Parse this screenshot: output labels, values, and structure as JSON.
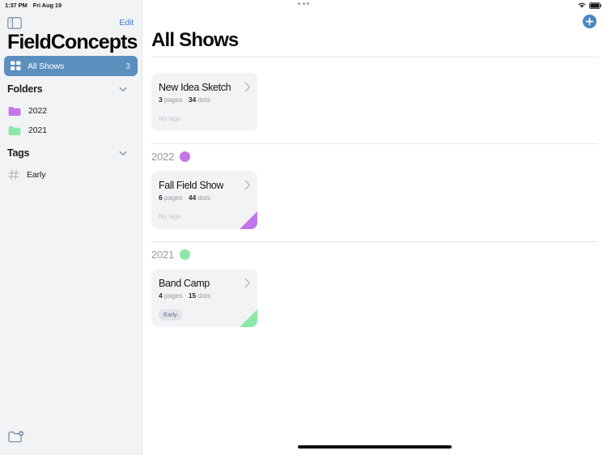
{
  "status_bar": {
    "time": "1:37 PM",
    "date": "Fri Aug 19",
    "wifi_icon": "wifi-icon",
    "battery_icon": "battery-icon",
    "multitask_icon": "multitasking-dots-icon"
  },
  "sidebar": {
    "toggle_icon": "sidebar-toggle-icon",
    "edit_label": "Edit",
    "app_title": "FieldConcepts",
    "all_shows": {
      "icon": "grid-icon",
      "label": "All Shows",
      "count": "3"
    },
    "sections": [
      {
        "title": "Folders",
        "chevron_icon": "chevron-down-icon",
        "items": [
          {
            "label": "2022",
            "icon": "folder-icon",
            "color": "#c376ea"
          },
          {
            "label": "2021",
            "icon": "folder-icon",
            "color": "#8de8a7"
          }
        ]
      },
      {
        "title": "Tags",
        "chevron_icon": "chevron-down-icon",
        "items": [
          {
            "label": "Early",
            "icon": "hash-icon",
            "color": "#b9bbc0"
          }
        ]
      }
    ],
    "new_folder_icon": "new-folder-icon"
  },
  "main": {
    "title": "All Shows",
    "add_icon": "add-plus-icon",
    "cards": [
      {
        "title": "New Idea Sketch",
        "pages_count": "3",
        "pages_label": "pages",
        "dots_count": "34",
        "dots_label": "dots",
        "tag_text": "No tags",
        "has_tag": false,
        "corner_color": "none",
        "chevron_icon": "chevron-right-icon"
      },
      {
        "title": "Fall Field Show",
        "pages_count": "6",
        "pages_label": "pages",
        "dots_count": "44",
        "dots_label": "dots",
        "tag_text": "No tags",
        "has_tag": false,
        "corner_color": "#c376ea",
        "chevron_icon": "chevron-right-icon"
      },
      {
        "title": "Band Camp",
        "pages_count": "4",
        "pages_label": "pages",
        "dots_count": "15",
        "dots_label": "dots",
        "tag_text": "Early",
        "has_tag": true,
        "corner_color": "#8de8a7",
        "chevron_icon": "chevron-right-icon"
      }
    ],
    "groups": [
      {
        "name": "2022",
        "dot_color": "#c376ea"
      },
      {
        "name": "2021",
        "dot_color": "#8de8a7"
      }
    ]
  },
  "colors": {
    "accent_blue": "#3c7fd0",
    "selected_row": "#5b8fbe",
    "sidebar_bg": "#f2f3f5",
    "card_bg": "#f2f3f5",
    "purple": "#c376ea",
    "green": "#8de8a7"
  }
}
